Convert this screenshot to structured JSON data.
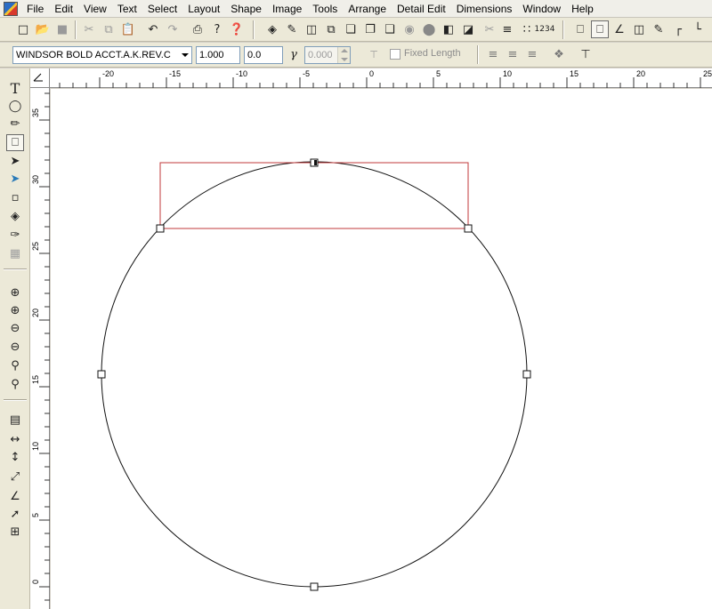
{
  "menu": [
    "File",
    "Edit",
    "View",
    "Text",
    "Select",
    "Layout",
    "Shape",
    "Image",
    "Tools",
    "Arrange",
    "Detail Edit",
    "Dimensions",
    "Window",
    "Help"
  ],
  "toolbar1": {
    "icons": [
      "new-file-icon",
      "open-folder-icon",
      "save-icon",
      "cut-icon",
      "copy-icon",
      "paste-icon",
      "undo-icon",
      "redo-icon",
      "print-icon",
      "help-icon",
      "context-help-icon",
      "fill-icon",
      "pen-node-icon",
      "node-tools-icon",
      "weld-icon",
      "group-icon",
      "ungroup-icon",
      "combine-icon",
      "circle-gray-icon",
      "circle-dark-icon",
      "mirror-icon",
      "flip-icon",
      "slice-icon",
      "align-icon",
      "distribute-icon",
      "number-sequence-icon",
      "node-edit-icon",
      "node-edit-selected-icon",
      "line-tool-icon",
      "car-shape-icon",
      "brush-icon",
      "corner-icon",
      "corner-trim-icon",
      "corner-round-icon"
    ]
  },
  "toolbar2": {
    "font_name": "WINDSOR BOLD ACCT.A.K.REV.C",
    "scale_value": "1.000",
    "slant_value": "0.0",
    "length_value": "0.000",
    "fixed_length_label": "Fixed Length"
  },
  "tools": [
    "text-tool-icon",
    "ellipse-tool-icon",
    "pencil-tool-icon",
    "node-edit-tool-icon",
    "select-arrow-icon",
    "node-select-arrow-icon",
    "page-tool-icon",
    "fill-bucket-icon",
    "eyedropper-icon",
    "pattern-icon",
    "zoom-in-icon",
    "zoom-in-plus-icon",
    "zoom-out-icon",
    "zoom-out-minus-icon",
    "zoom-fit-icon",
    "zoom-all-icon",
    "page-layout-icon",
    "horizontal-dimension-icon",
    "vertical-dimension-icon",
    "angled-dimension-icon",
    "angle-dimension-icon",
    "leader-dimension-icon",
    "crop-icon"
  ],
  "ruler": {
    "h_labels": [
      "-20",
      "-15",
      "-10",
      "-5",
      "0",
      "5",
      "10",
      "15",
      "20",
      "25"
    ],
    "v_labels": [
      "35",
      "30",
      "25",
      "20",
      "15",
      "10",
      "5",
      "0"
    ]
  },
  "colors": {
    "selection": "#c0393b",
    "shape": "#111111",
    "background": "#ffffff"
  }
}
